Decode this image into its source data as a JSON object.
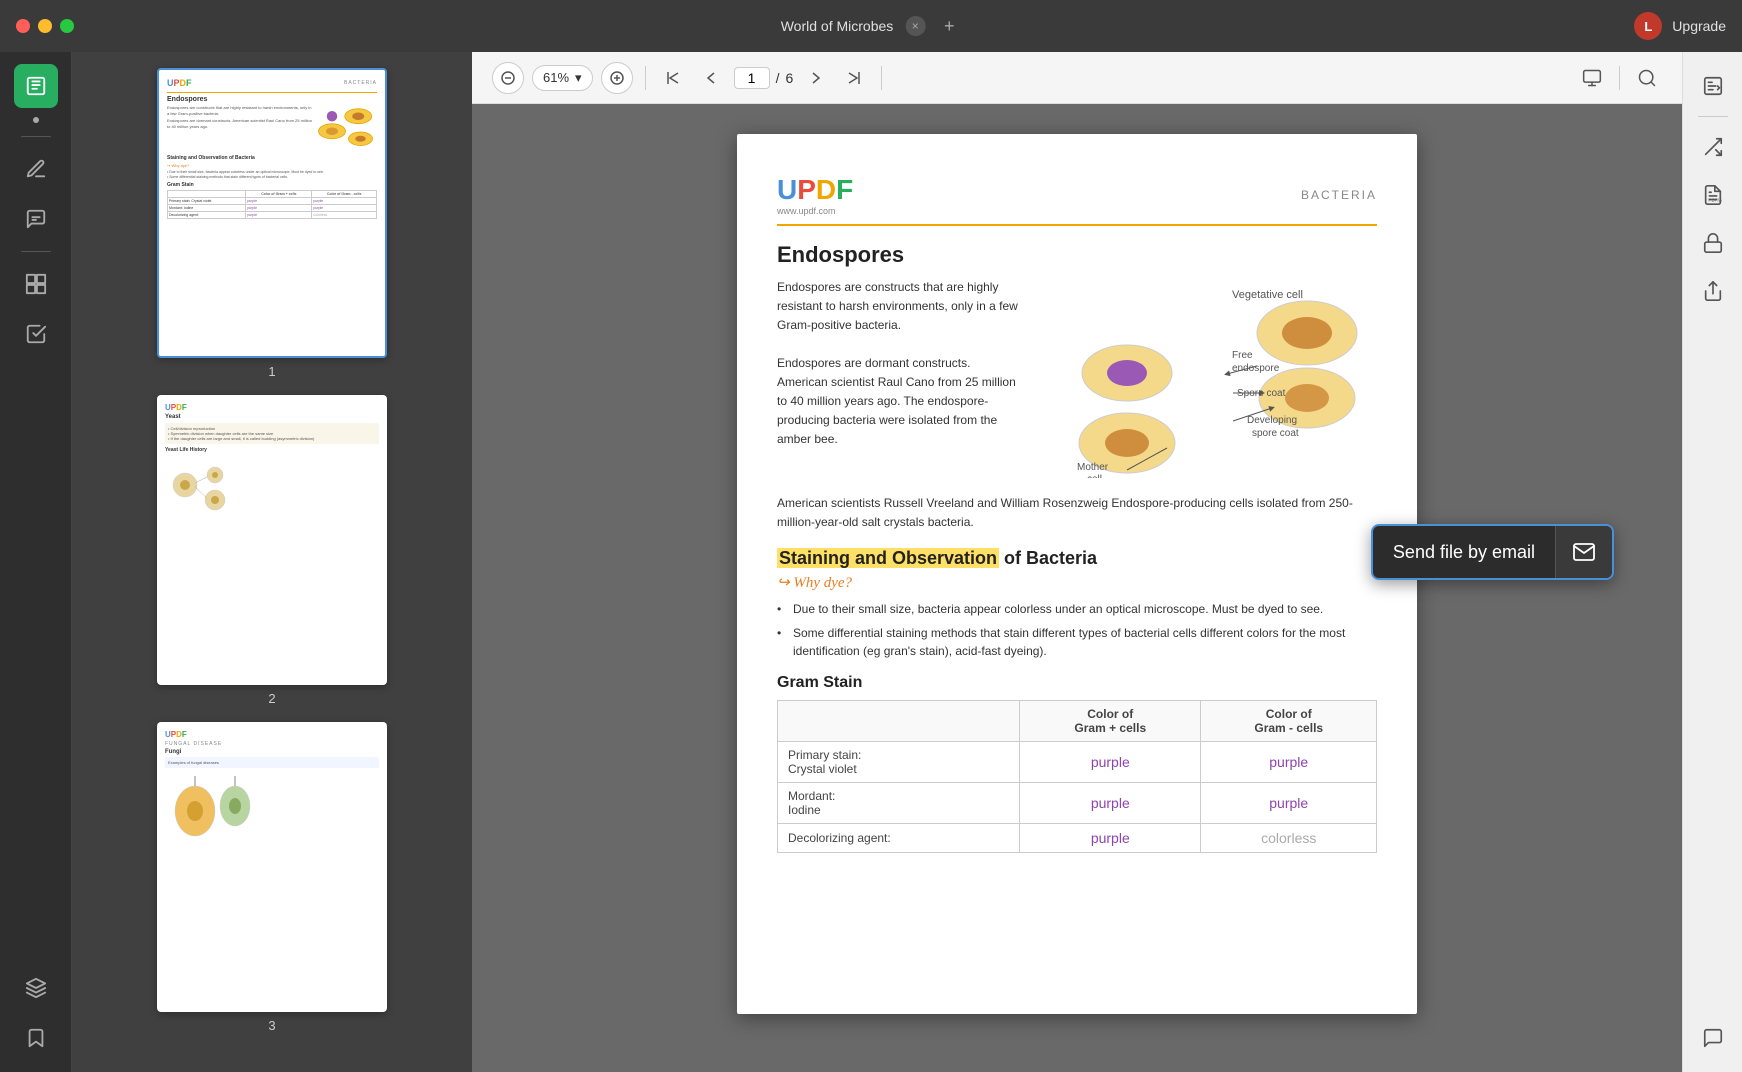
{
  "titlebar": {
    "title": "World of Microbes",
    "close_label": "×",
    "add_label": "+",
    "upgrade_label": "Upgrade",
    "avatar_letter": "L"
  },
  "toolbar": {
    "zoom_level": "61%",
    "current_page": "1",
    "total_pages": "6",
    "zoom_in_label": "+",
    "zoom_out_label": "−",
    "zoom_dropdown": "▾"
  },
  "sidebar": {
    "icons": [
      "reader",
      "pen",
      "annotation",
      "pages",
      "stamps",
      "layers",
      "bookmark"
    ]
  },
  "pdf": {
    "logo": "UPDF",
    "logo_url": "www.updf.com",
    "bacteria_label": "BACTERIA",
    "section_title": "Endospores",
    "para1": "Endospores are constructs that are highly resistant to harsh environments, only in a few Gram-positive bacteria.",
    "para2": "Endospores are dormant constructs. American scientist Raul Cano from 25 million to 40 million years ago. The endospore-producing bacteria were isolated from the amber bee.",
    "para3": "American scientists Russell Vreeland and William Rosenzweig Endospore-producing cells isolated from 250-million-year-old salt crystals bacteria.",
    "staining_title_bold": "Staining and Observation",
    "staining_title_rest": " of Bacteria",
    "why_dye": "Why dye?",
    "bullet1": "Due to their small size, bacteria appear colorless under an optical microscope. Must be dyed to see.",
    "bullet2": "Some differential staining methods that stain different types of bacterial cells different colors for the most identification (eg gran's stain), acid-fast dyeing).",
    "gram_stain_title": "Gram Stain",
    "table": {
      "col1": "",
      "col2": "Color of\nGram + cells",
      "col3": "Color of\nGram - cells",
      "rows": [
        {
          "label": "Primary stain:\nCrystal violet",
          "col2": "purple",
          "col3": "purple"
        },
        {
          "label": "Mordant:\nIodine",
          "col2": "purple",
          "col3": "purple"
        },
        {
          "label": "Decolorizing agent:",
          "col2": "purple",
          "col3": "colorless"
        }
      ]
    }
  },
  "diagram": {
    "labels": [
      "Vegetative cell",
      "Free endospore",
      "Spore coat",
      "Developing spore coat",
      "Mother cell"
    ]
  },
  "send_email": {
    "label": "Send file by email",
    "icon": "✉"
  },
  "thumbnails": [
    {
      "number": "1",
      "active": true
    },
    {
      "number": "2",
      "active": false
    },
    {
      "number": "3",
      "active": false
    }
  ],
  "right_sidebar": {
    "icons": [
      "ocr",
      "convert",
      "pdf-a",
      "protect",
      "share",
      "chat"
    ]
  }
}
